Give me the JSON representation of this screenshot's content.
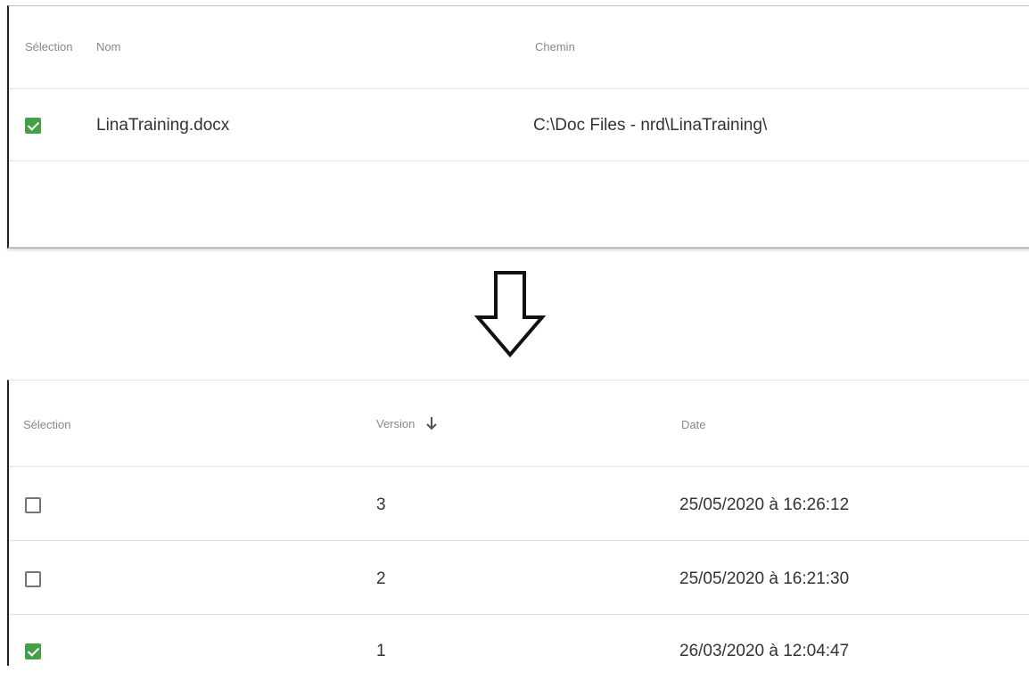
{
  "files_table": {
    "headers": {
      "selection": "Sélection",
      "name": "Nom",
      "path": "Chemin"
    },
    "rows": [
      {
        "selected": true,
        "name": "LinaTraining.docx",
        "path": "C:\\Doc Files - nrd\\LinaTraining\\"
      }
    ]
  },
  "transition_icon": "down-arrow-icon",
  "versions_table": {
    "headers": {
      "selection": "Sélection",
      "version": "Version",
      "date": "Date"
    },
    "sort_icon": "arrow-down-icon",
    "rows": [
      {
        "selected": false,
        "version": "3",
        "date": "25/05/2020 à 16:26:12"
      },
      {
        "selected": false,
        "version": "2",
        "date": "25/05/2020 à 16:21:30"
      },
      {
        "selected": true,
        "version": "1",
        "date": "26/03/2020 à 12:04:47"
      }
    ]
  },
  "colors": {
    "checkbox_checked": "#43a047",
    "header_text": "#888888",
    "row_divider": "#e3e3e3"
  }
}
